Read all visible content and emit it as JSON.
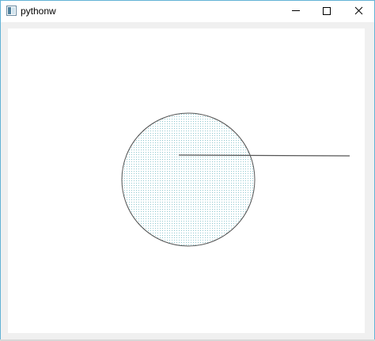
{
  "window": {
    "title": "pythonw",
    "app_icon": "python-window-icon",
    "accent_color": "#63b3d6"
  },
  "caption_buttons": {
    "minimize_icon": "minimize-icon",
    "maximize_icon": "maximize-icon",
    "close_icon": "close-icon"
  },
  "canvas": {
    "background": "#ffffff",
    "circle": {
      "stroke_color": "#555555",
      "fill_pattern": "dotted",
      "fill_color": "#8fc7cf"
    },
    "line": {
      "stroke_color": "#555555"
    }
  }
}
